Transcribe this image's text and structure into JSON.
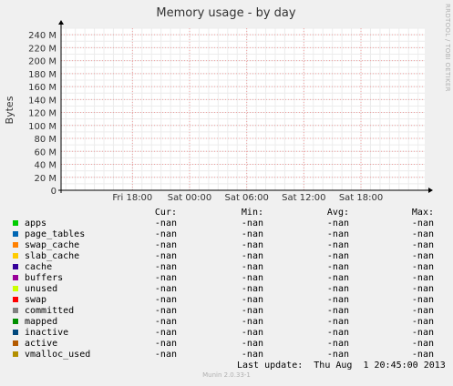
{
  "chart_data": {
    "type": "area",
    "title": "Memory usage - by day",
    "ylabel": "Bytes",
    "xlabel": "",
    "ylim_mb": [
      0,
      250
    ],
    "y_ticks": [
      "0",
      "20 M",
      "40 M",
      "60 M",
      "80 M",
      "100 M",
      "120 M",
      "140 M",
      "160 M",
      "180 M",
      "200 M",
      "220 M",
      "240 M"
    ],
    "x_ticks": [
      "Fri 18:00",
      "Sat 00:00",
      "Sat 06:00",
      "Sat 12:00",
      "Sat 18:00"
    ],
    "x_range_hours": [
      -7.5,
      30.7
    ],
    "x_tick_hours": [
      0,
      6,
      12,
      18,
      24
    ],
    "grid": true,
    "series": [
      {
        "name": "apps",
        "color": "#00cc00",
        "cur": "-nan",
        "min": "-nan",
        "avg": "-nan",
        "max": "-nan"
      },
      {
        "name": "page_tables",
        "color": "#0066b3",
        "cur": "-nan",
        "min": "-nan",
        "avg": "-nan",
        "max": "-nan"
      },
      {
        "name": "swap_cache",
        "color": "#ff8000",
        "cur": "-nan",
        "min": "-nan",
        "avg": "-nan",
        "max": "-nan"
      },
      {
        "name": "slab_cache",
        "color": "#ffcc00",
        "cur": "-nan",
        "min": "-nan",
        "avg": "-nan",
        "max": "-nan"
      },
      {
        "name": "cache",
        "color": "#330099",
        "cur": "-nan",
        "min": "-nan",
        "avg": "-nan",
        "max": "-nan"
      },
      {
        "name": "buffers",
        "color": "#990099",
        "cur": "-nan",
        "min": "-nan",
        "avg": "-nan",
        "max": "-nan"
      },
      {
        "name": "unused",
        "color": "#ccff00",
        "cur": "-nan",
        "min": "-nan",
        "avg": "-nan",
        "max": "-nan"
      },
      {
        "name": "swap",
        "color": "#ff0000",
        "cur": "-nan",
        "min": "-nan",
        "avg": "-nan",
        "max": "-nan"
      },
      {
        "name": "committed",
        "color": "#808080",
        "cur": "-nan",
        "min": "-nan",
        "avg": "-nan",
        "max": "-nan"
      },
      {
        "name": "mapped",
        "color": "#008f00",
        "cur": "-nan",
        "min": "-nan",
        "avg": "-nan",
        "max": "-nan"
      },
      {
        "name": "inactive",
        "color": "#00487d",
        "cur": "-nan",
        "min": "-nan",
        "avg": "-nan",
        "max": "-nan"
      },
      {
        "name": "active",
        "color": "#b35a00",
        "cur": "-nan",
        "min": "-nan",
        "avg": "-nan",
        "max": "-nan"
      },
      {
        "name": "vmalloc_used",
        "color": "#b38f00",
        "cur": "-nan",
        "min": "-nan",
        "avg": "-nan",
        "max": "-nan"
      }
    ]
  },
  "legend": {
    "headers": {
      "cur": "Cur:",
      "min": "Min:",
      "avg": "Avg:",
      "max": "Max:"
    }
  },
  "last_update": "Last update:  Thu Aug  1 20:45:00 2013",
  "footer": "Munin 2.0.33-1",
  "side_label": "RRDTOOL / TOBI OETIKER"
}
